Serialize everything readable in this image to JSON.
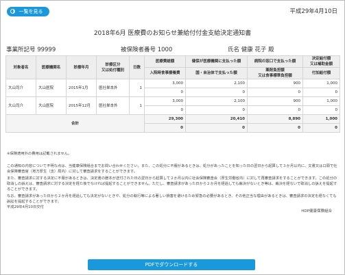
{
  "header": {
    "list_button_label": "一覧を見る",
    "issue_date": "平成29年4月10日"
  },
  "document": {
    "title": "2018年6月 医療費のお知らせ兼給付付金支給決定通知書",
    "office_label": "事業所記号 99999",
    "insured_label": "被保険者番号 1000",
    "name_label": "氏名 健康 花子 殿"
  },
  "table": {
    "headers": {
      "name": "対象者名",
      "institution": "医療機関名",
      "month": "診療年月",
      "category": "診療区分\n又は処付種別",
      "days": "日数",
      "total_cost": "医療費総額",
      "paid_to_institution": "健保が医療機関に支払った額",
      "clinic_paid": "病院の窓口で支払った額",
      "decision_amount": "決定給付額\n又は補助金額",
      "inpatient_meal": "入院時食事療養費",
      "public_paid": "国・自治体で支払った額",
      "high_cost": "薬剤負担額\n又は食事標準負担額",
      "additional": "付加給付額"
    },
    "rows": [
      {
        "name": "大山司介",
        "institution": "大山医院",
        "month": "2015年1月",
        "category": "医社単本外",
        "days": "1",
        "total_cost": "3,000",
        "inpatient_meal": "0",
        "paid_to_institution": "2,100",
        "public_paid": "0",
        "clinic_paid": "900",
        "high_cost": "0",
        "decision_amount": "1,000",
        "additional": "0"
      },
      {
        "name": "大山司介",
        "institution": "大山医院",
        "month": "2015年12月",
        "category": "医社単本外",
        "days": "1",
        "total_cost": "3,000",
        "inpatient_meal": "0",
        "paid_to_institution": "2,100",
        "public_paid": "0",
        "clinic_paid": "900",
        "high_cost": "0",
        "decision_amount": "1,000",
        "additional": "0"
      }
    ],
    "total": {
      "label": "合計",
      "total_cost": "29,300",
      "inpatient_meal": "0",
      "paid_to_institution": "20,410",
      "public_paid": "0",
      "clinic_paid": "8,890",
      "high_cost": "0",
      "decision_amount": "1,000",
      "additional": "0"
    }
  },
  "notes": {
    "footnote": "※保険適用外の費用は記載されません。",
    "paragraph1": "この通知の内容について不明な点は、当健康保険組合までお問い合わせください。また、この処分に不服があるときは、処分があったことを知った日の翌日から起算して３か月以内に、文書又は口頭で社会保険審査官（地方厚生（支）局内）に対して審査請求をすることができます。",
    "paragraph2": "また、審査請求に対する決定に不服があるときは、決定書の謄本が送付された日の翌日から起算して２か月以内に社会保険審査会（厚生労働省内）に対して再審査請求をすることができます。この処分の取消しの訴えは、審査請求に対する決定を経た後でなければ提起することができません。ただし、審査請求があった日から２か月を経過しても裁決がないとき等は、裁決を経ないで取消しの訴えを提起することができます。",
    "paragraph3": "なお、審査請求があった日から２か月を経過しても決定がないときや、処分の執行等による著しい損害を避けるため緊急の必要があるとき、その他正当な理由があるときは、審査請求の決定を経なくても訴訟を提起することができます。",
    "notice_date": "平成29年4月10日交付",
    "issuer": "HDP健康保険組合"
  },
  "footer": {
    "pdf_button_label": "PDFでダウンロードする"
  }
}
